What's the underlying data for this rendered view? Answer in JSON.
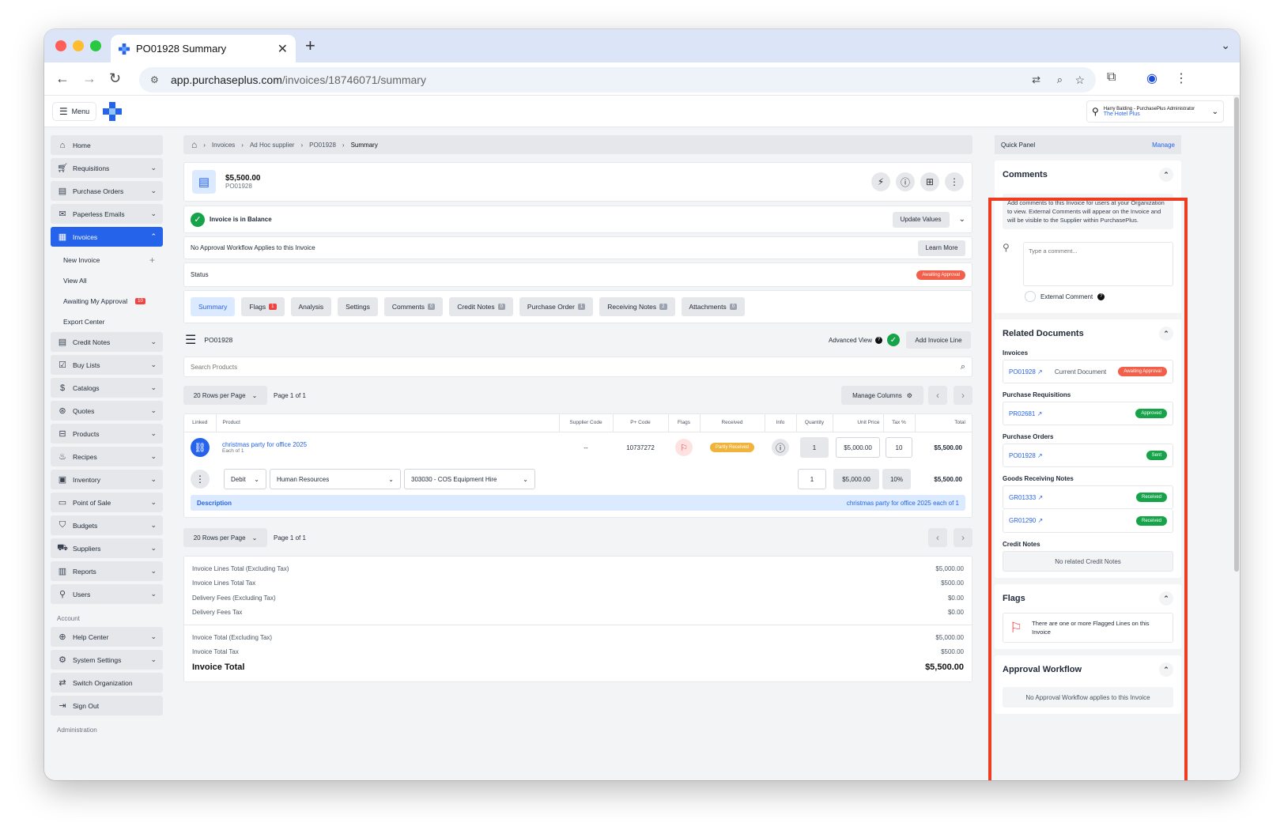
{
  "browser": {
    "tab_title": "PO01928 Summary",
    "url_host": "app.purchaseplus.com",
    "url_path": "/invoices/18746071/summary"
  },
  "header": {
    "menu_label": "Menu",
    "user_name": "Harry Balding - PurchasePlus Administrator",
    "org_name": "The Hotel Plus"
  },
  "sidebar": {
    "items": [
      {
        "label": "Home",
        "icon": "home-icon"
      },
      {
        "label": "Requisitions",
        "icon": "cart-icon"
      },
      {
        "label": "Purchase Orders",
        "icon": "clipboard-icon"
      },
      {
        "label": "Paperless Emails",
        "icon": "mail-icon"
      },
      {
        "label": "Invoices",
        "icon": "invoice-icon"
      }
    ],
    "invoice_sub": [
      {
        "label": "New Invoice"
      },
      {
        "label": "View All"
      },
      {
        "label": "Awaiting My Approval",
        "badge": "10"
      },
      {
        "label": "Export Center"
      }
    ],
    "items2": [
      {
        "label": "Credit Notes"
      },
      {
        "label": "Buy Lists"
      },
      {
        "label": "Catalogs"
      },
      {
        "label": "Quotes"
      },
      {
        "label": "Products"
      },
      {
        "label": "Recipes"
      },
      {
        "label": "Inventory"
      },
      {
        "label": "Point of Sale"
      },
      {
        "label": "Budgets"
      },
      {
        "label": "Suppliers"
      },
      {
        "label": "Reports"
      },
      {
        "label": "Users"
      }
    ],
    "account_label": "Account",
    "account_items": [
      {
        "label": "Help Center"
      },
      {
        "label": "System Settings"
      },
      {
        "label": "Switch Organization"
      },
      {
        "label": "Sign Out"
      }
    ],
    "admin_label": "Administration"
  },
  "breadcrumb": [
    "Invoices",
    "Ad Hoc supplier",
    "PO01928",
    "Summary"
  ],
  "invoice": {
    "amount": "$5,500.00",
    "number": "PO01928",
    "balance_text": "Invoice is in Balance",
    "update_values": "Update Values",
    "workflow_text": "No Approval Workflow Applies to this Invoice",
    "learn_more": "Learn More",
    "status_label": "Status",
    "status_value": "Awaiting Approval"
  },
  "tabs": [
    {
      "label": "Summary",
      "active": true
    },
    {
      "label": "Flags",
      "count": "1",
      "red": true
    },
    {
      "label": "Analysis"
    },
    {
      "label": "Settings"
    },
    {
      "label": "Comments",
      "count": "0"
    },
    {
      "label": "Credit Notes",
      "count": "0"
    },
    {
      "label": "Purchase Order",
      "count": "1"
    },
    {
      "label": "Receiving Notes",
      "count": "2"
    },
    {
      "label": "Attachments",
      "count": "0"
    }
  ],
  "lines": {
    "title": "PO01928",
    "advanced_view": "Advanced View",
    "add_line": "Add Invoice Line",
    "search_placeholder": "Search Products",
    "rows_per_page": "20 Rows per Page",
    "page_info": "Page 1 of 1",
    "manage_columns": "Manage Columns",
    "columns": [
      "Linked",
      "Product",
      "Supplier Code",
      "P+ Code",
      "Flags",
      "Received",
      "Info",
      "Quantity",
      "Unit Price",
      "Tax %",
      "Total"
    ],
    "row": {
      "product": "christmas party for office 2025",
      "product_sub": "Each of 1",
      "supplier_code": "--",
      "pplus_code": "10737272",
      "received": "Partly Received",
      "quantity": "1",
      "unit_price": "$5,000.00",
      "tax": "10",
      "total": "$5,500.00"
    },
    "line_detail": {
      "type": "Debit",
      "department": "Human Resources",
      "account": "303030 - COS Equipment Hire",
      "quantity": "1",
      "unit_price": "$5,000.00",
      "tax": "10%",
      "total": "$5,500.00"
    },
    "description_label": "Description",
    "description_value": "christmas party for office 2025 each of 1"
  },
  "totals": [
    {
      "label": "Invoice Lines Total (Excluding Tax)",
      "value": "$5,000.00"
    },
    {
      "label": "Invoice Lines Total Tax",
      "value": "$500.00"
    },
    {
      "label": "Delivery Fees (Excluding Tax)",
      "value": "$0.00"
    },
    {
      "label": "Delivery Fees Tax",
      "value": "$0.00"
    }
  ],
  "totals2": [
    {
      "label": "Invoice Total (Excluding Tax)",
      "value": "$5,000.00"
    },
    {
      "label": "Invoice Total Tax",
      "value": "$500.00"
    }
  ],
  "invoice_total": {
    "label": "Invoice Total",
    "value": "$5,500.00"
  },
  "quick_panel": {
    "title": "Quick Panel",
    "manage": "Manage",
    "comments_title": "Comments",
    "comments_info": "Add comments to this Invoice for users at your Organization to view. External Comments will appear on the Invoice and will be visible to the Supplier within PurchasePlus.",
    "comment_placeholder": "Type a comment...",
    "external_comment": "External Comment",
    "related_title": "Related Documents",
    "invoices_label": "Invoices",
    "invoice_doc": "PO01928",
    "current_doc": "Current Document",
    "invoice_status": "Awaiting Approval",
    "req_label": "Purchase Requisitions",
    "req_doc": "PR02681",
    "req_status": "Approved",
    "po_label": "Purchase Orders",
    "po_doc": "PO01928",
    "po_status": "Sent",
    "grn_label": "Goods Receiving Notes",
    "grn1": "GR01333",
    "grn1_status": "Received",
    "grn2": "GR01290",
    "grn2_status": "Received",
    "credit_label": "Credit Notes",
    "no_credit": "No related Credit Notes",
    "flags_title": "Flags",
    "flags_text": "There are one or more Flagged Lines on this Invoice",
    "approval_title": "Approval Workflow",
    "approval_text": "No Approval Workflow applies to this Invoice"
  },
  "colors": {
    "accent": "#2563eb",
    "danger": "#ef4444",
    "success": "#16a34a",
    "warning": "#f0b43c",
    "highlight_frame": "#ef3b1f"
  }
}
